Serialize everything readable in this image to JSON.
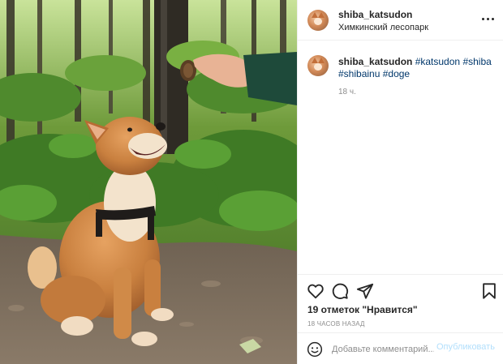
{
  "header": {
    "username": "shiba_katsudon",
    "location": "Химкинский лесопарк",
    "more_icon": "more-horizontal-icon"
  },
  "caption": {
    "username": "shiba_katsudon",
    "hashtags": [
      "#katsudon",
      "#shiba",
      "#shibainu",
      "#doge"
    ],
    "time": "18 ч."
  },
  "actions": {
    "icons": [
      "heart-icon",
      "comment-icon",
      "share-icon",
      "bookmark-icon"
    ],
    "likes": "19 отметок \"Нравится\"",
    "posted": "18 ЧАСОВ НАЗАД"
  },
  "comment": {
    "emoji_icon": "smiley-icon",
    "placeholder": "Добавьте комментарий...",
    "publish_label": "Опубликовать"
  },
  "colors": {
    "hashtag": "#00376b",
    "publish_disabled": "#b2dffc",
    "secondary_text": "#8e8e8e",
    "divider": "#efefef"
  }
}
